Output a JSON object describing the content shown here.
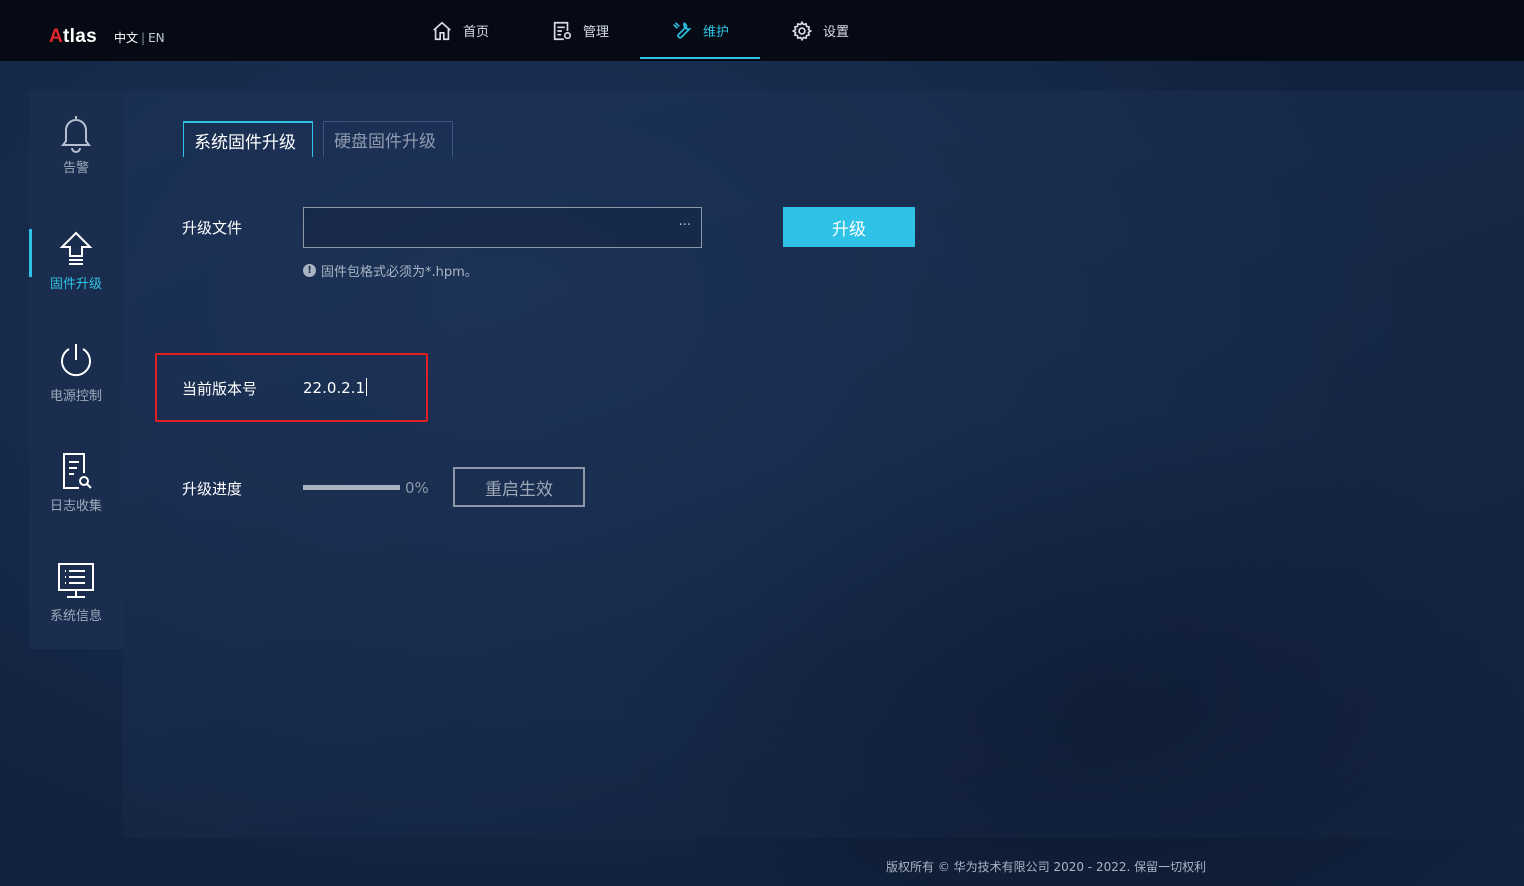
{
  "header": {
    "logo_first": "A",
    "logo_rest": "tlas",
    "lang_zh": "中文",
    "lang_sep": "|",
    "lang_en": "EN",
    "nav": [
      {
        "label": "首页",
        "icon": "home-icon"
      },
      {
        "label": "管理",
        "icon": "manage-icon"
      },
      {
        "label": "维护",
        "icon": "wrench-icon",
        "active": true
      },
      {
        "label": "设置",
        "icon": "gear-icon"
      }
    ]
  },
  "sidebar": {
    "items": [
      {
        "label": "告警",
        "icon": "bell-icon"
      },
      {
        "label": "固件升级",
        "icon": "upgrade-arrow-icon",
        "active": true
      },
      {
        "label": "电源控制",
        "icon": "power-icon"
      },
      {
        "label": "日志收集",
        "icon": "log-search-icon"
      },
      {
        "label": "系统信息",
        "icon": "monitor-list-icon"
      }
    ]
  },
  "tabs": [
    {
      "label": "系统固件升级",
      "active": true
    },
    {
      "label": "硬盘固件升级",
      "active": false
    }
  ],
  "form": {
    "file_label": "升级文件",
    "file_value": "",
    "file_browse": "···",
    "hint": "固件包格式必须为*.hpm。",
    "hint_icon": "!",
    "upgrade_button": "升级",
    "version_label": "当前版本号",
    "version_value": "22.0.2.1",
    "progress_label": "升级进度",
    "progress_percent": 0,
    "progress_text": "0%",
    "restart_button": "重启生效"
  },
  "footer": {
    "copyright": "版权所有 © 华为技术有限公司 2020 - 2022. 保留一切权利"
  },
  "colors": {
    "accent": "#2ec3e6",
    "logo_red": "#e3262b",
    "highlight_red": "#e02020"
  }
}
